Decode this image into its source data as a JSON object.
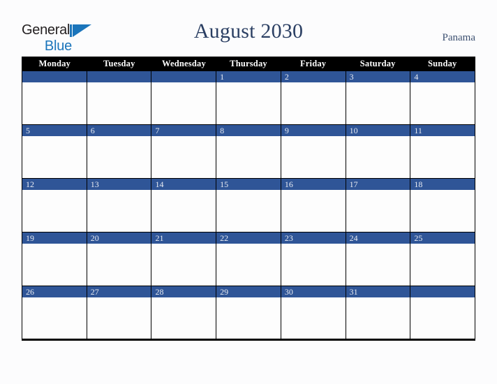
{
  "brand": {
    "name_part1": "General",
    "name_part2": "Blue",
    "mark": "triangle-logo-icon"
  },
  "header": {
    "title": "August 2030",
    "locale": "Panama"
  },
  "calendar": {
    "month": "August",
    "year": "2030",
    "weekday_headers": [
      "Monday",
      "Tuesday",
      "Wednesday",
      "Thursday",
      "Friday",
      "Saturday",
      "Sunday"
    ],
    "colors": {
      "header_bar": "#000000",
      "day_bar": "#2f5597",
      "title_text": "#2b3f63",
      "brand_blue": "#1b75bb",
      "page_background": "#fcfcfd"
    },
    "weeks": [
      [
        {
          "num": ""
        },
        {
          "num": ""
        },
        {
          "num": ""
        },
        {
          "num": "1"
        },
        {
          "num": "2"
        },
        {
          "num": "3"
        },
        {
          "num": "4"
        }
      ],
      [
        {
          "num": "5"
        },
        {
          "num": "6"
        },
        {
          "num": "7"
        },
        {
          "num": "8"
        },
        {
          "num": "9"
        },
        {
          "num": "10"
        },
        {
          "num": "11"
        }
      ],
      [
        {
          "num": "12"
        },
        {
          "num": "13"
        },
        {
          "num": "14"
        },
        {
          "num": "15"
        },
        {
          "num": "16"
        },
        {
          "num": "17"
        },
        {
          "num": "18"
        }
      ],
      [
        {
          "num": "19"
        },
        {
          "num": "20"
        },
        {
          "num": "21"
        },
        {
          "num": "22"
        },
        {
          "num": "23"
        },
        {
          "num": "24"
        },
        {
          "num": "25"
        }
      ],
      [
        {
          "num": "26"
        },
        {
          "num": "27"
        },
        {
          "num": "28"
        },
        {
          "num": "29"
        },
        {
          "num": "30"
        },
        {
          "num": "31"
        },
        {
          "num": ""
        }
      ]
    ]
  }
}
